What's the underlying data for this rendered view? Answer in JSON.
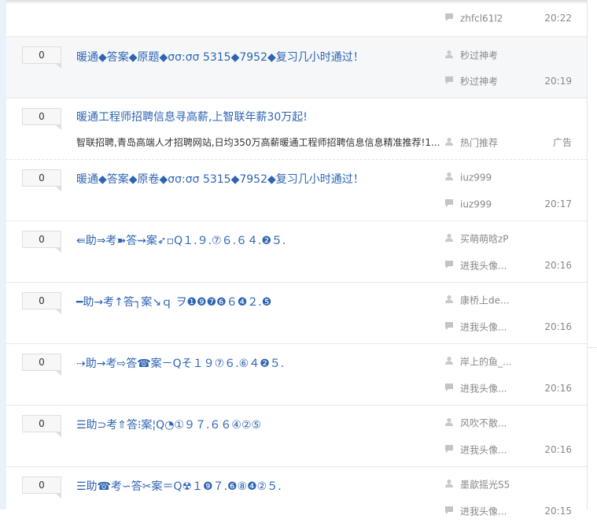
{
  "rows": [
    {
      "count": "",
      "title": "",
      "author": "",
      "last_replier": "zhfcl61l2",
      "time": "20:22",
      "partial_top": true
    },
    {
      "count": "0",
      "title": "暖通◆答案◆原题◆σσ:σσ 5315◆7952◆复习几小时通过！",
      "author": "秒过神考",
      "last_replier": "秒过神考",
      "time": "20:19",
      "highlight": true
    },
    {
      "count": "0",
      "title": "暖通工程师招聘信息寻高薪,上智联年薪30万起!",
      "description": "智联招聘,青岛高端人才招聘网站,日均350万高薪暖通工程师招聘信息信息精准推荐!1...",
      "author": "热门推荐",
      "time": "广告",
      "ad": true
    },
    {
      "count": "0",
      "title": "暖通◆答案◆原卷◆σσ:σσ 5315◆7952◆复习几小时通过！",
      "author": "iuz999",
      "last_replier": "iuz999",
      "time": "20:17"
    },
    {
      "count": "0",
      "title": "⇚助⇒考➽答⇝案➶▫Q１.９.⑦６.６４.❷５.",
      "author": "买萌萌晗zP",
      "last_replier": "进我头像...",
      "time": "20:16"
    },
    {
      "count": "0",
      "title": "━助→考↑答┐案↘ｑ ヲ❶❾❼❻６❹２.❺",
      "author": "康桥上de...",
      "last_replier": "进我头像...",
      "time": "20:16"
    },
    {
      "count": "0",
      "title": "⇢助→考⇨答☎案－Qそ１９⑦６.⑥４❷５.",
      "author": "岸上的鱼_...",
      "last_replier": "进我头像...",
      "time": "20:16"
    },
    {
      "count": "0",
      "title": "☰助⊃考⇑答⁝案¦Q◔①９７.６６④②⑤",
      "author": "风吹不散...",
      "last_replier": "进我头像...",
      "time": "20:16"
    },
    {
      "count": "0",
      "title": "☰助☎考∽答✂案＝Q☢１❾７.❻⑧❹②５.",
      "author": "墨歆摇光S5",
      "last_replier": "进我头像...",
      "time": "20:15"
    }
  ],
  "colors": {
    "title_blue": "#2d64b3",
    "meta_gray": "#888888",
    "highlight_bg": "#f6f7f9",
    "left_accent": "#e9f2fb"
  },
  "icons": {
    "author": "user-icon",
    "reply": "reply-icon"
  }
}
